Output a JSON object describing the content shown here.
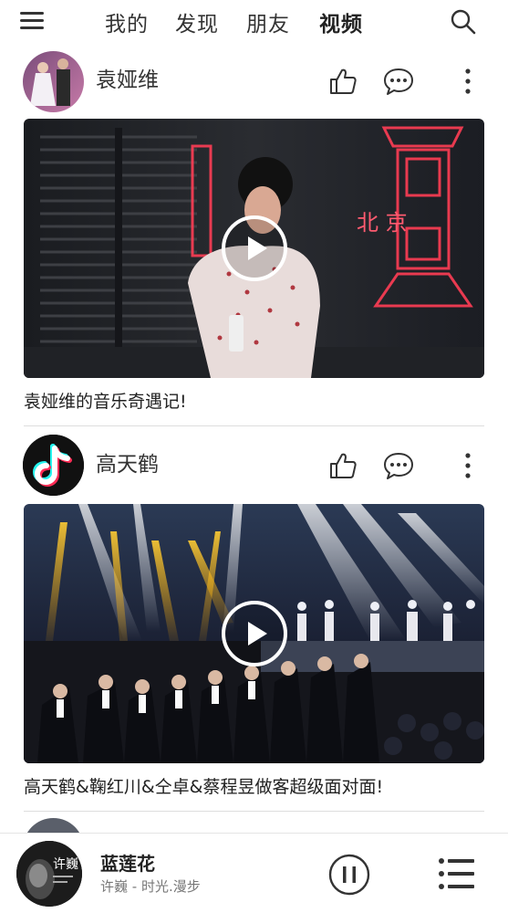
{
  "header": {
    "tabs": [
      {
        "label": "我的"
      },
      {
        "label": "发现"
      },
      {
        "label": "朋友"
      },
      {
        "label": "视频"
      }
    ],
    "active_tab": "视频"
  },
  "feed": [
    {
      "author": "袁娅维",
      "title": "袁娅维的音乐奇遇记!",
      "video_sign_text": "北 京"
    },
    {
      "author": "高天鹤",
      "title": "高天鹤&鞠红川&仝卓&蔡程昱做客超级面对面!"
    }
  ],
  "now_playing": {
    "song": "蓝莲花",
    "artist": "许巍 - 时光.漫步",
    "cover_text": "许巍"
  },
  "icons": {
    "menu": "hamburger-menu-icon",
    "search": "search-icon",
    "like": "thumbs-up-icon",
    "comment": "comment-bubble-icon",
    "more": "more-vertical-icon",
    "play": "play-circle-icon",
    "pause": "pause-circle-icon",
    "playlist": "playlist-icon"
  },
  "colors": {
    "neon": "#ff3d55",
    "text": "#333333",
    "divider": "#dddddd"
  }
}
